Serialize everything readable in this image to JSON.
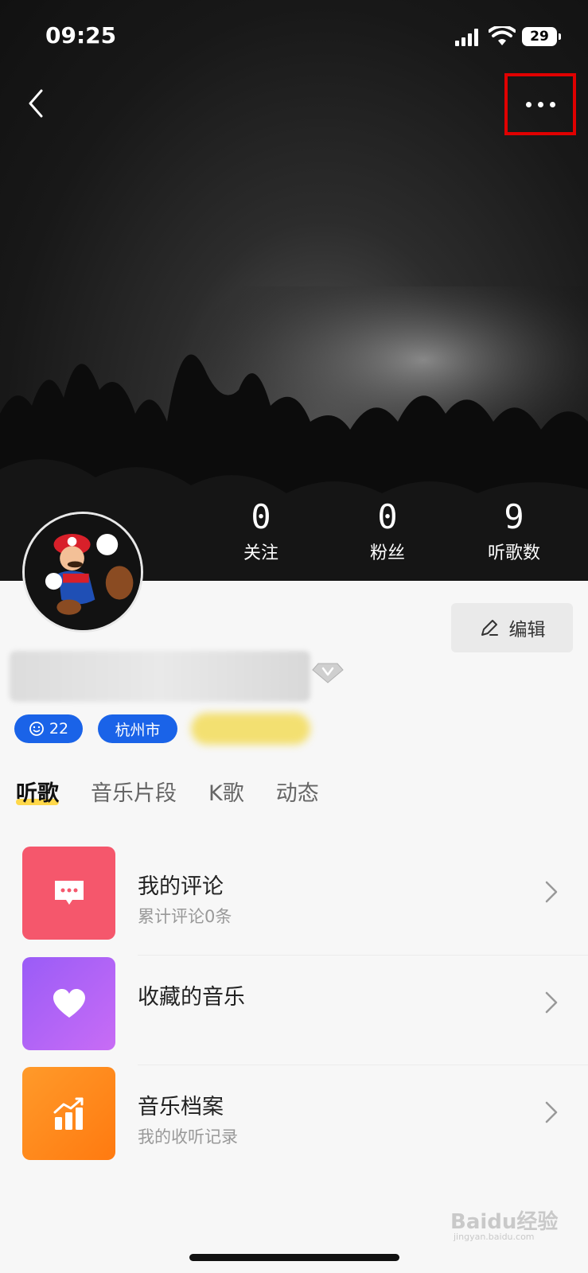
{
  "status_bar": {
    "time": "09:25",
    "battery": "29"
  },
  "stats": [
    {
      "value": "0",
      "label": "关注"
    },
    {
      "value": "0",
      "label": "粉丝"
    },
    {
      "value": "9",
      "label": "听歌数"
    }
  ],
  "profile": {
    "edit_label": "编辑",
    "level": "22",
    "city": "杭州市"
  },
  "tabs": [
    "听歌",
    "音乐片段",
    "K歌",
    "动态"
  ],
  "list": [
    {
      "title": "我的评论",
      "subtitle": "累计评论0条",
      "color": "#f5576c",
      "icon": "comment-icon"
    },
    {
      "title": "收藏的音乐",
      "subtitle": "",
      "color": "#b65cf7",
      "icon": "heart-icon"
    },
    {
      "title": "音乐档案",
      "subtitle": "我的收听记录",
      "color": "#ff8a1f",
      "icon": "chart-icon"
    }
  ],
  "watermark": {
    "brand": "Baidu经验",
    "url": "jingyan.baidu.com"
  },
  "colors": {
    "accent_blue": "#1a63e8",
    "highlight_red": "#e00000",
    "tab_underline": "#ffd84a"
  }
}
